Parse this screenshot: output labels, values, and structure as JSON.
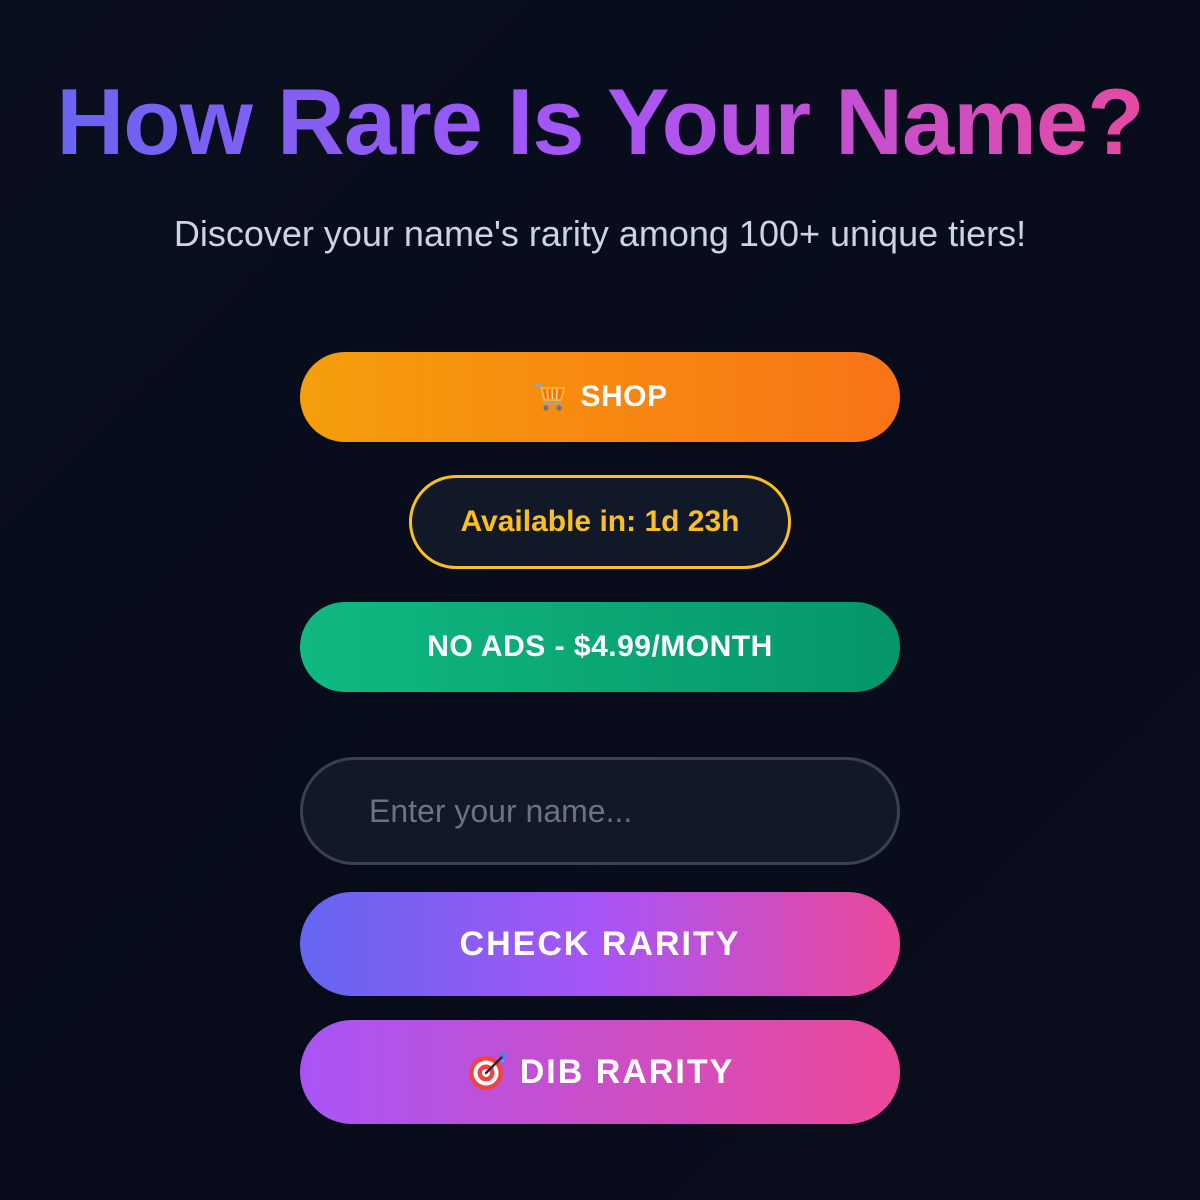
{
  "header": {
    "title": "How Rare Is Your Name?",
    "subtitle": "Discover your name's rarity among 100+ unique tiers!"
  },
  "shop": {
    "icon": "shopping-cart-icon",
    "label": "SHOP"
  },
  "timer": {
    "label": "Available in: 1d 23h"
  },
  "no_ads": {
    "label": "NO ADS - $4.99/MONTH"
  },
  "name_input": {
    "value": "",
    "placeholder": "Enter your name..."
  },
  "check_button": {
    "label": "CHECK RARITY"
  },
  "dib_button": {
    "icon": "target-icon",
    "label": "DIB RARITY"
  },
  "colors": {
    "background": "#070b1a",
    "title_gradient_start": "#6366f1",
    "title_gradient_end": "#ec4899",
    "shop_orange": "#f97316",
    "timer_gold": "#fbbf24",
    "no_ads_green": "#10b981"
  }
}
